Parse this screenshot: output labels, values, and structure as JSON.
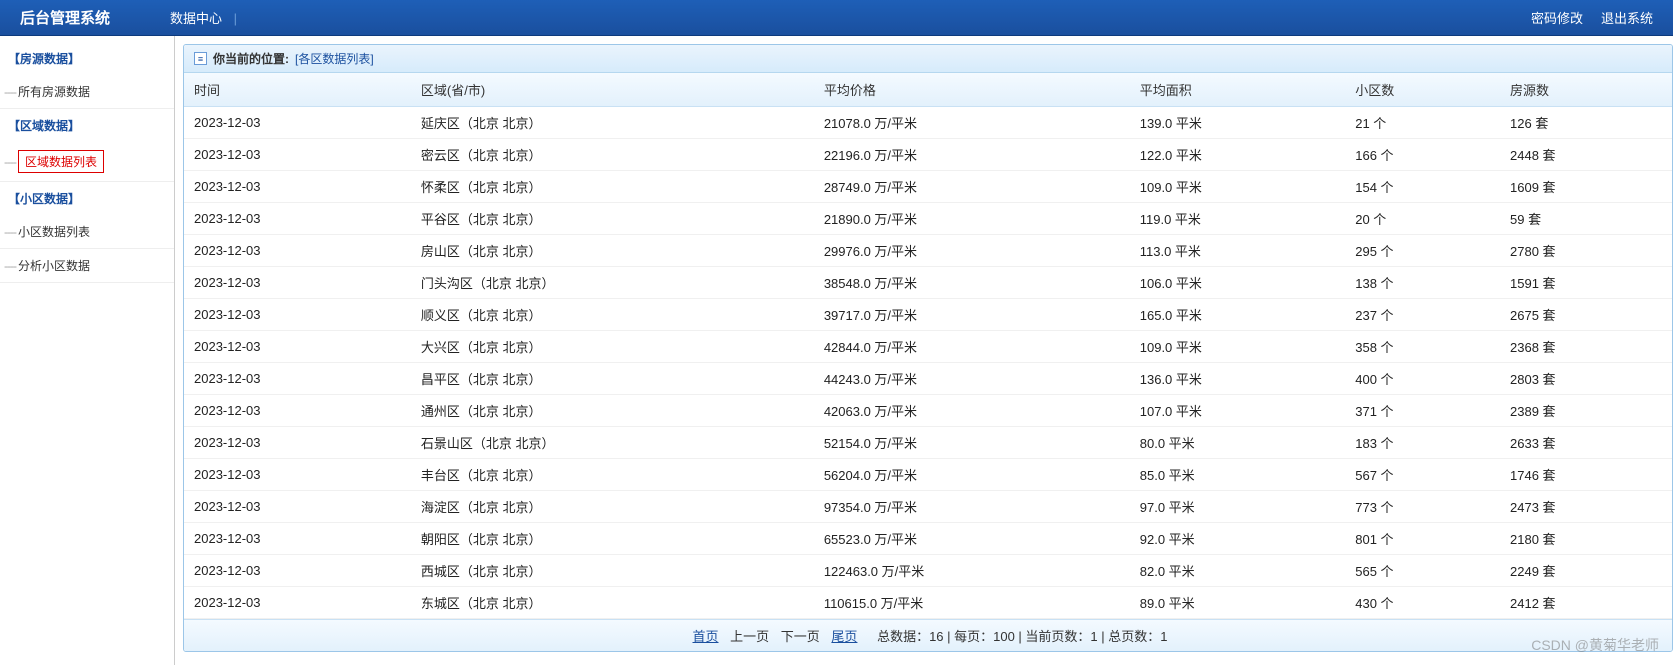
{
  "topbar": {
    "title": "后台管理系统",
    "menu": {
      "data_center": "数据中心"
    },
    "right": {
      "change_pw": "密码修改",
      "logout": "退出系统"
    }
  },
  "sidebar": {
    "groups": [
      {
        "title": "【房源数据】",
        "items": [
          {
            "label": "所有房源数据",
            "active": false
          }
        ]
      },
      {
        "title": "【区域数据】",
        "items": [
          {
            "label": "区域数据列表",
            "active": true
          }
        ]
      },
      {
        "title": "【小区数据】",
        "items": [
          {
            "label": "小区数据列表",
            "active": false
          },
          {
            "label": "分析小区数据",
            "active": false
          }
        ]
      }
    ]
  },
  "breadcrumb": {
    "label": "你当前的位置:",
    "path": "[各区数据列表]"
  },
  "table": {
    "headers": [
      "时间",
      "区域(省/市)",
      "平均价格",
      "平均面积",
      "小区数",
      "房源数"
    ],
    "rows": [
      [
        "2023-12-03",
        "延庆区（北京 北京）",
        "21078.0 万/平米",
        "139.0 平米",
        "21 个",
        "126 套"
      ],
      [
        "2023-12-03",
        "密云区（北京 北京）",
        "22196.0 万/平米",
        "122.0 平米",
        "166 个",
        "2448 套"
      ],
      [
        "2023-12-03",
        "怀柔区（北京 北京）",
        "28749.0 万/平米",
        "109.0 平米",
        "154 个",
        "1609 套"
      ],
      [
        "2023-12-03",
        "平谷区（北京 北京）",
        "21890.0 万/平米",
        "119.0 平米",
        "20 个",
        "59 套"
      ],
      [
        "2023-12-03",
        "房山区（北京 北京）",
        "29976.0 万/平米",
        "113.0 平米",
        "295 个",
        "2780 套"
      ],
      [
        "2023-12-03",
        "门头沟区（北京 北京）",
        "38548.0 万/平米",
        "106.0 平米",
        "138 个",
        "1591 套"
      ],
      [
        "2023-12-03",
        "顺义区（北京 北京）",
        "39717.0 万/平米",
        "165.0 平米",
        "237 个",
        "2675 套"
      ],
      [
        "2023-12-03",
        "大兴区（北京 北京）",
        "42844.0 万/平米",
        "109.0 平米",
        "358 个",
        "2368 套"
      ],
      [
        "2023-12-03",
        "昌平区（北京 北京）",
        "44243.0 万/平米",
        "136.0 平米",
        "400 个",
        "2803 套"
      ],
      [
        "2023-12-03",
        "通州区（北京 北京）",
        "42063.0 万/平米",
        "107.0 平米",
        "371 个",
        "2389 套"
      ],
      [
        "2023-12-03",
        "石景山区（北京 北京）",
        "52154.0 万/平米",
        "80.0 平米",
        "183 个",
        "2633 套"
      ],
      [
        "2023-12-03",
        "丰台区（北京 北京）",
        "56204.0 万/平米",
        "85.0 平米",
        "567 个",
        "1746 套"
      ],
      [
        "2023-12-03",
        "海淀区（北京 北京）",
        "97354.0 万/平米",
        "97.0 平米",
        "773 个",
        "2473 套"
      ],
      [
        "2023-12-03",
        "朝阳区（北京 北京）",
        "65523.0 万/平米",
        "92.0 平米",
        "801 个",
        "2180 套"
      ],
      [
        "2023-12-03",
        "西城区（北京 北京）",
        "122463.0 万/平米",
        "82.0 平米",
        "565 个",
        "2249 套"
      ],
      [
        "2023-12-03",
        "东城区（北京 北京）",
        "110615.0 万/平米",
        "89.0 平米",
        "430 个",
        "2412 套"
      ]
    ]
  },
  "pager": {
    "first": "首页",
    "prev": "上一页",
    "next": "下一页",
    "last": "尾页",
    "info": "总数据：16 | 每页：100 | 当前页数：1 | 总页数：1"
  },
  "watermark": "CSDN @黄菊华老师"
}
